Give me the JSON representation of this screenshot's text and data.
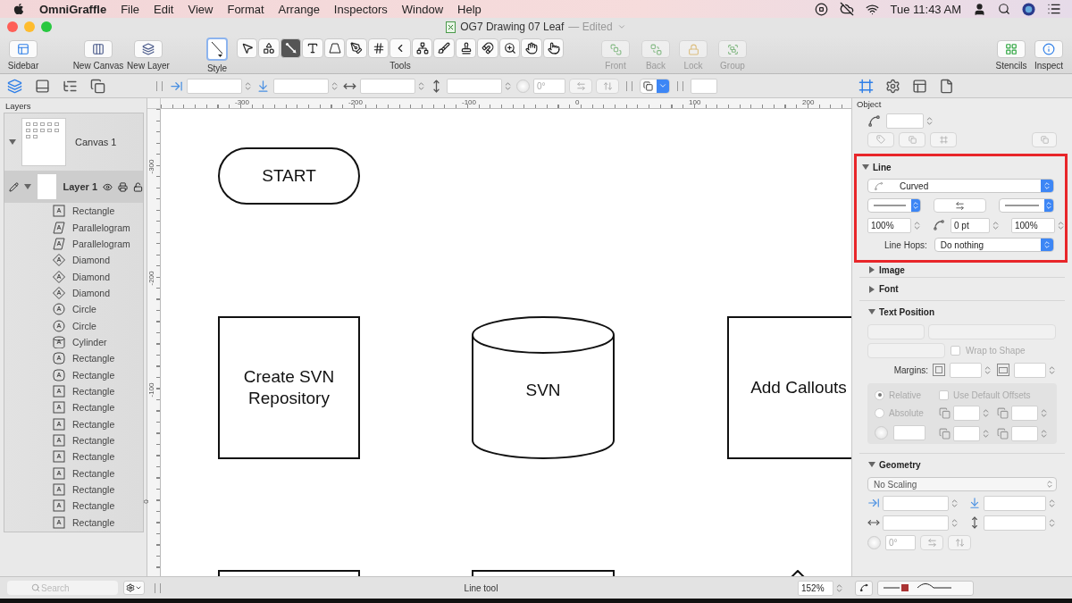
{
  "menu_bar": {
    "app": "OmniGraffle",
    "items": [
      "File",
      "Edit",
      "View",
      "Format",
      "Arrange",
      "Inspectors",
      "Window",
      "Help"
    ],
    "clock": "Tue 11:43 AM"
  },
  "window": {
    "title": "OG7 Drawing 07 Leaf",
    "status": "— Edited"
  },
  "toolbar": {
    "left": [
      {
        "label": "Sidebar"
      },
      {
        "label": "New Canvas"
      },
      {
        "label": "New Layer"
      }
    ],
    "style_label": "Style",
    "tools_label": "Tools",
    "tools": [
      {
        "selected": false
      },
      {
        "selected": false
      },
      {
        "selected": true
      },
      {
        "selected": false
      },
      {
        "selected": false
      },
      {
        "selected": false
      },
      {
        "selected": false
      },
      {
        "selected": false
      },
      {
        "selected": false
      },
      {
        "selected": false
      },
      {
        "selected": false
      },
      {
        "selected": false
      },
      {
        "selected": false
      },
      {
        "selected": false
      },
      {
        "selected": false
      }
    ],
    "arrange": [
      {
        "label": "Front",
        "disabled": true
      },
      {
        "label": "Back",
        "disabled": true
      },
      {
        "label": "Lock",
        "disabled": true
      },
      {
        "label": "Group",
        "disabled": true
      }
    ],
    "right": [
      {
        "label": "Stencils"
      },
      {
        "label": "Inspect"
      }
    ]
  },
  "format_bar": {
    "rotation": "0°"
  },
  "sidebar": {
    "tabs": [
      {
        "selected": true
      },
      {
        "selected": false
      },
      {
        "selected": false
      },
      {
        "selected": false
      }
    ],
    "title": "Layers",
    "canvas": {
      "name": "Canvas 1",
      "expanded": true
    },
    "layer": {
      "name": "Layer 1",
      "expanded": true,
      "selected": true
    },
    "items": [
      {
        "name": "Rectangle",
        "kind": "rect"
      },
      {
        "name": "Parallelogram",
        "kind": "parallelogram"
      },
      {
        "name": "Parallelogram",
        "kind": "parallelogram"
      },
      {
        "name": "Diamond",
        "kind": "diamond"
      },
      {
        "name": "Diamond",
        "kind": "diamond"
      },
      {
        "name": "Diamond",
        "kind": "diamond"
      },
      {
        "name": "Circle",
        "kind": "circle"
      },
      {
        "name": "Circle",
        "kind": "circle"
      },
      {
        "name": "Cylinder",
        "kind": "cylinder"
      },
      {
        "name": "Rectangle",
        "kind": "rounded"
      },
      {
        "name": "Rectangle",
        "kind": "rounded"
      },
      {
        "name": "Rectangle",
        "kind": "rect"
      },
      {
        "name": "Rectangle",
        "kind": "rect"
      },
      {
        "name": "Rectangle",
        "kind": "rect"
      },
      {
        "name": "Rectangle",
        "kind": "rect"
      },
      {
        "name": "Rectangle",
        "kind": "rect"
      },
      {
        "name": "Rectangle",
        "kind": "rect"
      },
      {
        "name": "Rectangle",
        "kind": "rect"
      },
      {
        "name": "Rectangle",
        "kind": "rect"
      },
      {
        "name": "Rectangle",
        "kind": "rect"
      }
    ],
    "search_placeholder": "Search"
  },
  "rulers": {
    "horizontal": [
      "-300",
      "-200",
      "-100",
      "0",
      "100",
      "200"
    ],
    "vertical": [
      "-300",
      "-200",
      "-100",
      "0"
    ]
  },
  "canvas": {
    "shapes": [
      {
        "kind": "terminator",
        "text": "START"
      },
      {
        "kind": "rect",
        "text": "Create SVN Repository"
      },
      {
        "kind": "cylinder",
        "text": "SVN"
      },
      {
        "kind": "rect",
        "text": "Add Callouts"
      },
      {
        "kind": "rect"
      },
      {
        "kind": "rect"
      },
      {
        "kind": "diamond"
      }
    ]
  },
  "inspector": {
    "tabs": [
      {
        "selected": true
      },
      {
        "selected": false
      },
      {
        "selected": false
      },
      {
        "selected": false
      }
    ],
    "title": "Object",
    "line": {
      "title": "Line",
      "expanded": true,
      "highlighted": true,
      "type": "Curved",
      "head_scale": "100%",
      "corner": "0 pt",
      "tail_scale": "100%",
      "hops_label": "Line Hops:",
      "hops": "Do nothing"
    },
    "collapsed": [
      {
        "title": "Image",
        "expanded": false
      },
      {
        "title": "Font",
        "expanded": false
      }
    ],
    "text_position": {
      "title": "Text Position",
      "expanded": true,
      "wrap_label": "Wrap to Shape",
      "wrap": false,
      "margins_label": "Margins:",
      "options": [
        {
          "label": "Relative",
          "selected": true
        },
        {
          "label": "Absolute",
          "selected": false
        }
      ],
      "default_offsets_label": "Use Default Offsets",
      "default_offsets": false
    },
    "geometry": {
      "title": "Geometry",
      "expanded": true,
      "scaling": "No Scaling",
      "rotation": "0°"
    }
  },
  "status_bar": {
    "text": "Line tool",
    "zoom": "152%"
  }
}
